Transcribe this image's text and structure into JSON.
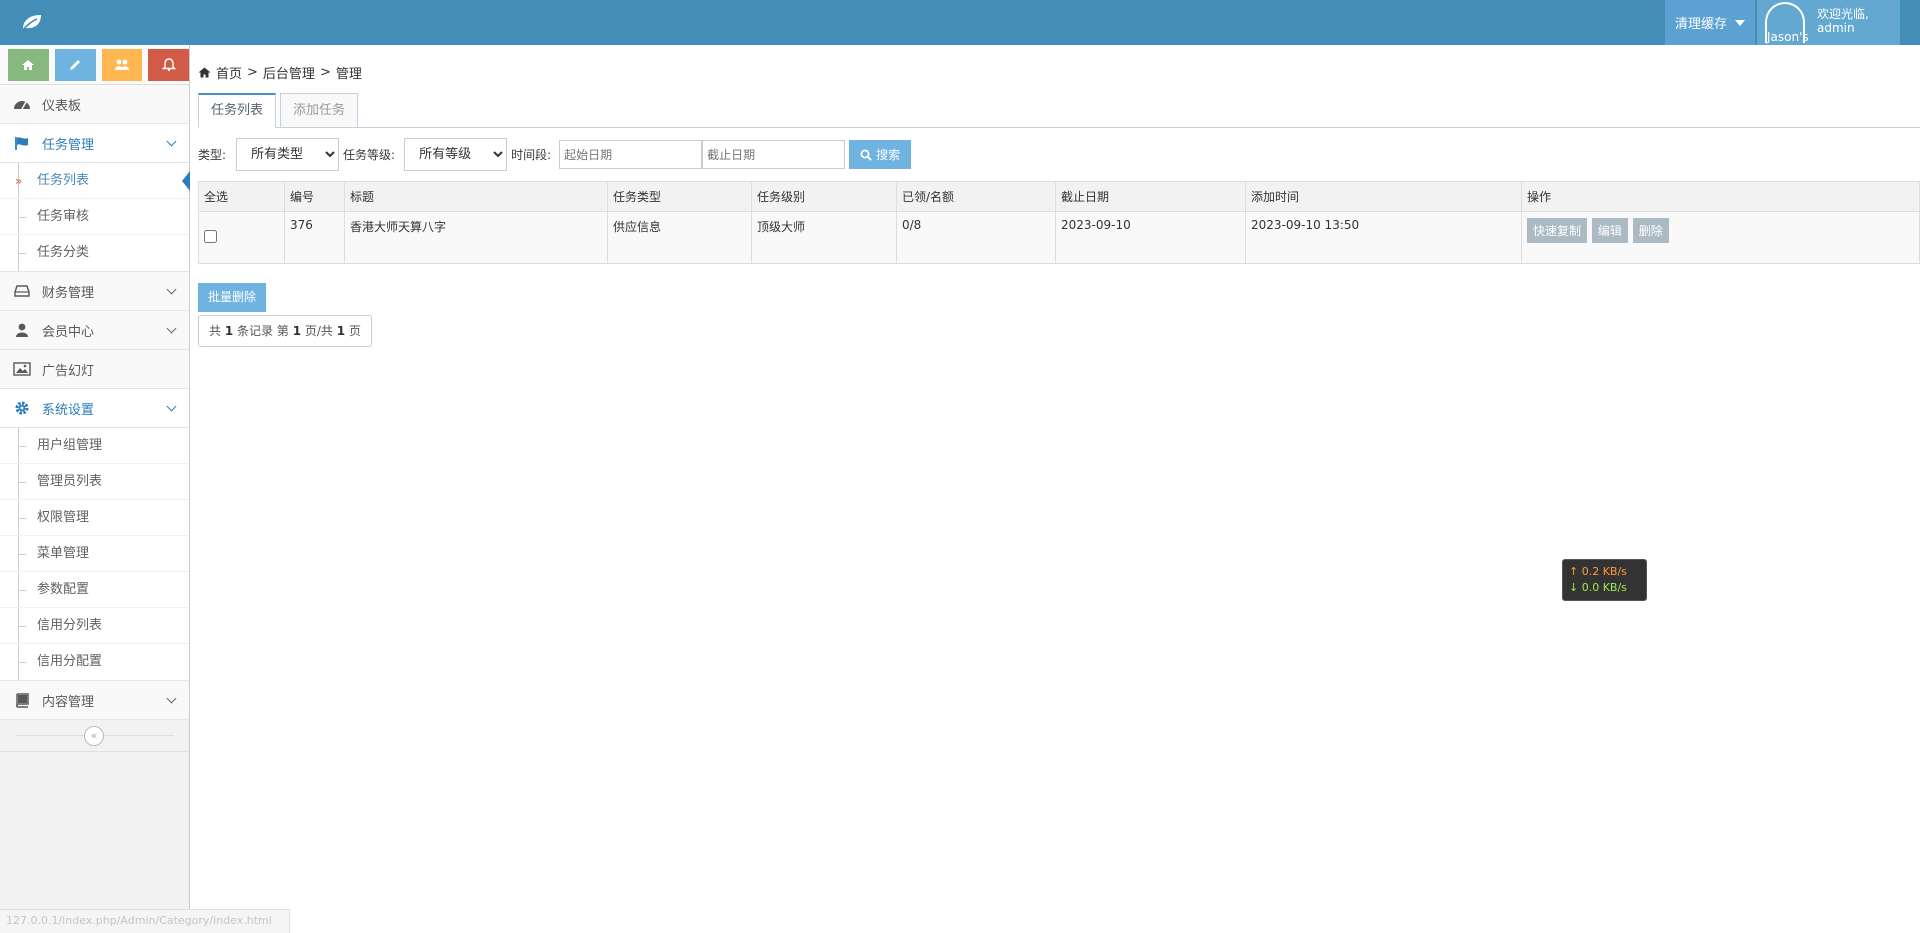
{
  "header": {
    "clear_cache": "清理缓存",
    "avatar_alt": "Jason's",
    "welcome": "欢迎光临,",
    "username": "admin"
  },
  "sidebar": {
    "items": [
      {
        "label": "仪表板"
      },
      {
        "label": "任务管理",
        "children": [
          "任务列表",
          "任务审核",
          "任务分类"
        ]
      },
      {
        "label": "财务管理"
      },
      {
        "label": "会员中心"
      },
      {
        "label": "广告幻灯"
      },
      {
        "label": "系统设置",
        "children": [
          "用户组管理",
          "管理员列表",
          "权限管理",
          "菜单管理",
          "参数配置",
          "信用分列表",
          "信用分配置"
        ]
      },
      {
        "label": "内容管理"
      }
    ]
  },
  "breadcrumb": {
    "home": "首页",
    "sep1": ">",
    "level1": "后台管理",
    "sep2": ">",
    "level2": "管理"
  },
  "tabs": {
    "list": "任务列表",
    "add": "添加任务"
  },
  "filters": {
    "type_label": "类型:",
    "type_value": "所有类型",
    "level_label": "任务等级:",
    "level_value": "所有等级",
    "period_label": "时间段:",
    "start_placeholder": "起始日期",
    "end_placeholder": "截止日期",
    "search": "搜索"
  },
  "table": {
    "headers": [
      "全选",
      "编号",
      "标题",
      "任务类型",
      "任务级别",
      "已领/名额",
      "截止日期",
      "添加时间",
      "操作"
    ],
    "rows": [
      {
        "id": "376",
        "title": "香港大师天算八字",
        "type": "供应信息",
        "level": "顶级大师",
        "quota": "0/8",
        "deadline": "2023-09-10",
        "added": "2023-09-10 13:50",
        "actions": [
          "快速复制",
          "编辑",
          "删除"
        ]
      }
    ]
  },
  "batch_delete": "批量删除",
  "pager": {
    "p1": "共",
    "total": "1",
    "p2": "条记录 第",
    "page": "1",
    "p3": "页/共",
    "pages": "1",
    "p4": "页"
  },
  "netspeed": {
    "up": "↑ 0.2 KB/s",
    "down": "↓ 0.0 KB/s"
  },
  "statusbar": "127.0.0.1/index.php/Admin/Category/index.html",
  "colors": {
    "navbar": "#438eb9",
    "accent": "#6fb3e0",
    "active_menu": "#2b7dbc"
  }
}
